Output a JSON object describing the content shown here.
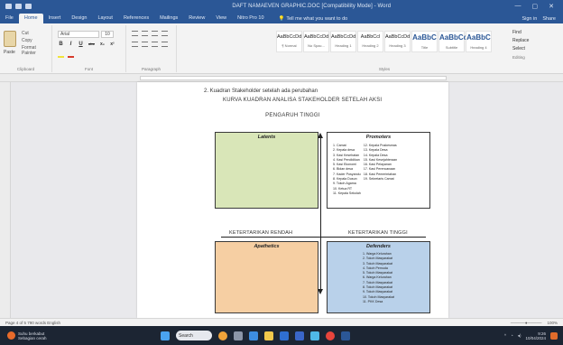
{
  "titlebar": {
    "doc_title": "DAFT NAMAEVEN GRAPHIC.DOC [Compatibility Mode] - Word",
    "controls": [
      "—",
      "▢",
      "✕"
    ]
  },
  "tabs": [
    "File",
    "Home",
    "Insert",
    "Design",
    "Layout",
    "References",
    "Mailings",
    "Review",
    "View",
    "Nitro Pro 10"
  ],
  "tell_me": "Tell me what you want to do",
  "account": [
    "Sign in",
    "Share"
  ],
  "ribbon": {
    "clipboard": {
      "paste": "Paste",
      "cut": "Cut",
      "copy": "Copy",
      "format_painter": "Format Painter",
      "label": "Clipboard"
    },
    "font": {
      "name": "Arial",
      "size": "10",
      "label": "Font",
      "buttons": [
        "B",
        "I",
        "U",
        "abc",
        "x₂",
        "x²"
      ]
    },
    "paragraph": {
      "label": "Paragraph"
    },
    "styles": {
      "label": "Styles",
      "items": [
        {
          "sample": "AaBbCcDd",
          "name": "¶ Normal",
          "big": false
        },
        {
          "sample": "AaBbCcDd",
          "name": "No Spac...",
          "big": false
        },
        {
          "sample": "AaBbCcDd",
          "name": "Heading 1",
          "big": false
        },
        {
          "sample": "AaBbCcl",
          "name": "Heading 2",
          "big": false
        },
        {
          "sample": "AaBbCcDd",
          "name": "Heading 3",
          "big": false
        },
        {
          "sample": "AaBbC",
          "name": "Title",
          "big": true
        },
        {
          "sample": "AaBbCc",
          "name": "Subtitle",
          "big": true
        },
        {
          "sample": "AaBbC",
          "name": "Heading 4",
          "big": true
        }
      ]
    },
    "editing": {
      "find": "Find",
      "replace": "Replace",
      "select": "Select",
      "label": "Editing"
    }
  },
  "document": {
    "heading": "2.  Kuadran Stakeholder setelah ada perubahan",
    "subheading": "KURVA KUADRAN ANALISA STAKEHOLDER SETELAH AKSI",
    "top_label": "PENGARUH TINGGI",
    "left_label": "KETERTARIKAN RENDAH",
    "right_label": "KETERTARIKAN TINGGI",
    "quadrants": {
      "latents": {
        "title": "Latents",
        "color": "#d9e6b8"
      },
      "promoters": {
        "title": "Promoters",
        "col1": [
          "1. Camat",
          "2. Kepala desa",
          "3. Kasi Kesehatan",
          "4. Kasi Pendidikan",
          "5. Kasi Ekonomi",
          "6. Bidan desa",
          "7. Kader Posyandu",
          "8. Kepala Dusun",
          "9. Tokoh Agama",
          "10. Ketua RT",
          "11. Kepala Sekolah"
        ],
        "col2": [
          "12. Kepala Puskesmas",
          "13. Kepala Desa",
          "14. Kepala Desa",
          "15. Kasi Kesejahteraan",
          "16. Kasi Pelayanan",
          "17. Kasi Perencanaan",
          "18. Kasi Pemerintahan",
          "19. Sekretaris Camat"
        ]
      },
      "apathetics": {
        "title": "Apathetics",
        "color": "#f6cfa3"
      },
      "defenders": {
        "title": "Defenders",
        "items": [
          "1. Warga Kelurahan",
          "2. Tokoh Masyarakat",
          "3. Tokoh Masyarakat",
          "4. Tokoh Pemuda",
          "5. Tokoh Masyarakat",
          "6. Warga Kelurahan",
          "7. Tokoh Masyarakat",
          "8. Tokoh Masyarakat",
          "9. Tokoh Masyarakat",
          "10. Tokoh Masyarakat",
          "11. PKK Desa"
        ]
      }
    }
  },
  "statusbar": {
    "left": "Page 4 of 5    790 words    English",
    "zoom": "100%"
  },
  "taskbar": {
    "weather_line1": "Suhu berkabut",
    "weather_line2": "Sebagian cerah",
    "search": "Search",
    "time": "9:26",
    "date": "10/04/2024"
  }
}
